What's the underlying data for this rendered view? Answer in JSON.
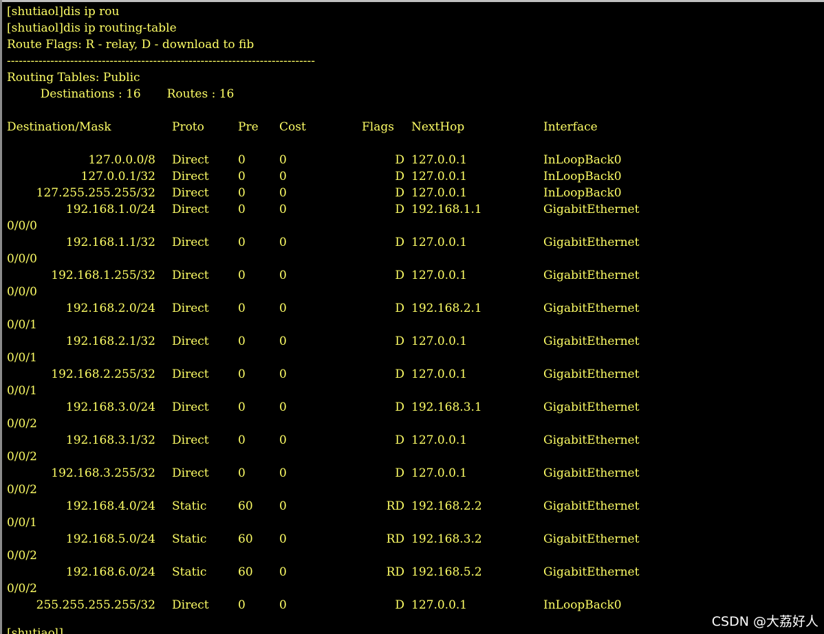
{
  "terminal": {
    "lines": {
      "cmd1": "[shutiaol]dis ip rou",
      "cmd2": "[shutiaol]dis ip routing-table",
      "flags_legend": "Route Flags: R - relay, D - download to fib",
      "separator": "------------------------------------------------------------------------------",
      "tables_title": "Routing Tables: Public",
      "summary": "         Destinations : 16       Routes : 16"
    },
    "headers": {
      "destination": "Destination/Mask",
      "proto": "Proto",
      "pre": "Pre",
      "cost": "Cost",
      "flags": "Flags",
      "nexthop": "NextHop",
      "interface": "Interface"
    },
    "routes": [
      {
        "dest": "127.0.0.0/8",
        "proto": "Direct",
        "pre": "0",
        "cost": "0",
        "flags": "D",
        "nexthop": "127.0.0.1",
        "iface": "InLoopBack0",
        "iface_cont": ""
      },
      {
        "dest": "127.0.0.1/32",
        "proto": "Direct",
        "pre": "0",
        "cost": "0",
        "flags": "D",
        "nexthop": "127.0.0.1",
        "iface": "InLoopBack0",
        "iface_cont": ""
      },
      {
        "dest": "127.255.255.255/32",
        "proto": "Direct",
        "pre": "0",
        "cost": "0",
        "flags": "D",
        "nexthop": "127.0.0.1",
        "iface": "InLoopBack0",
        "iface_cont": ""
      },
      {
        "dest": "192.168.1.0/24",
        "proto": "Direct",
        "pre": "0",
        "cost": "0",
        "flags": "D",
        "nexthop": "192.168.1.1",
        "iface": "GigabitEthernet",
        "iface_cont": "0/0/0"
      },
      {
        "dest": "192.168.1.1/32",
        "proto": "Direct",
        "pre": "0",
        "cost": "0",
        "flags": "D",
        "nexthop": "127.0.0.1",
        "iface": "GigabitEthernet",
        "iface_cont": "0/0/0"
      },
      {
        "dest": "192.168.1.255/32",
        "proto": "Direct",
        "pre": "0",
        "cost": "0",
        "flags": "D",
        "nexthop": "127.0.0.1",
        "iface": "GigabitEthernet",
        "iface_cont": "0/0/0"
      },
      {
        "dest": "192.168.2.0/24",
        "proto": "Direct",
        "pre": "0",
        "cost": "0",
        "flags": "D",
        "nexthop": "192.168.2.1",
        "iface": "GigabitEthernet",
        "iface_cont": "0/0/1"
      },
      {
        "dest": "192.168.2.1/32",
        "proto": "Direct",
        "pre": "0",
        "cost": "0",
        "flags": "D",
        "nexthop": "127.0.0.1",
        "iface": "GigabitEthernet",
        "iface_cont": "0/0/1"
      },
      {
        "dest": "192.168.2.255/32",
        "proto": "Direct",
        "pre": "0",
        "cost": "0",
        "flags": "D",
        "nexthop": "127.0.0.1",
        "iface": "GigabitEthernet",
        "iface_cont": "0/0/1"
      },
      {
        "dest": "192.168.3.0/24",
        "proto": "Direct",
        "pre": "0",
        "cost": "0",
        "flags": "D",
        "nexthop": "192.168.3.1",
        "iface": "GigabitEthernet",
        "iface_cont": "0/0/2"
      },
      {
        "dest": "192.168.3.1/32",
        "proto": "Direct",
        "pre": "0",
        "cost": "0",
        "flags": "D",
        "nexthop": "127.0.0.1",
        "iface": "GigabitEthernet",
        "iface_cont": "0/0/2"
      },
      {
        "dest": "192.168.3.255/32",
        "proto": "Direct",
        "pre": "0",
        "cost": "0",
        "flags": "D",
        "nexthop": "127.0.0.1",
        "iface": "GigabitEthernet",
        "iface_cont": "0/0/2"
      },
      {
        "dest": "192.168.4.0/24",
        "proto": "Static",
        "pre": "60",
        "cost": "0",
        "flags": "RD",
        "nexthop": "192.168.2.2",
        "iface": "GigabitEthernet",
        "iface_cont": "0/0/1"
      },
      {
        "dest": "192.168.5.0/24",
        "proto": "Static",
        "pre": "60",
        "cost": "0",
        "flags": "RD",
        "nexthop": "192.168.3.2",
        "iface": "GigabitEthernet",
        "iface_cont": "0/0/2"
      },
      {
        "dest": "192.168.6.0/24",
        "proto": "Static",
        "pre": "60",
        "cost": "0",
        "flags": "RD",
        "nexthop": "192.168.5.2",
        "iface": "GigabitEthernet",
        "iface_cont": "0/0/2"
      },
      {
        "dest": "255.255.255.255/32",
        "proto": "Direct",
        "pre": "0",
        "cost": "0",
        "flags": "D",
        "nexthop": "127.0.0.1",
        "iface": "InLoopBack0",
        "iface_cont": ""
      }
    ],
    "partial_prompt": "[shutiaol]"
  },
  "watermark": "CSDN @大荔好人",
  "colors": {
    "background": "#000000",
    "text": "#ffff66",
    "watermark": "#ffffff"
  }
}
